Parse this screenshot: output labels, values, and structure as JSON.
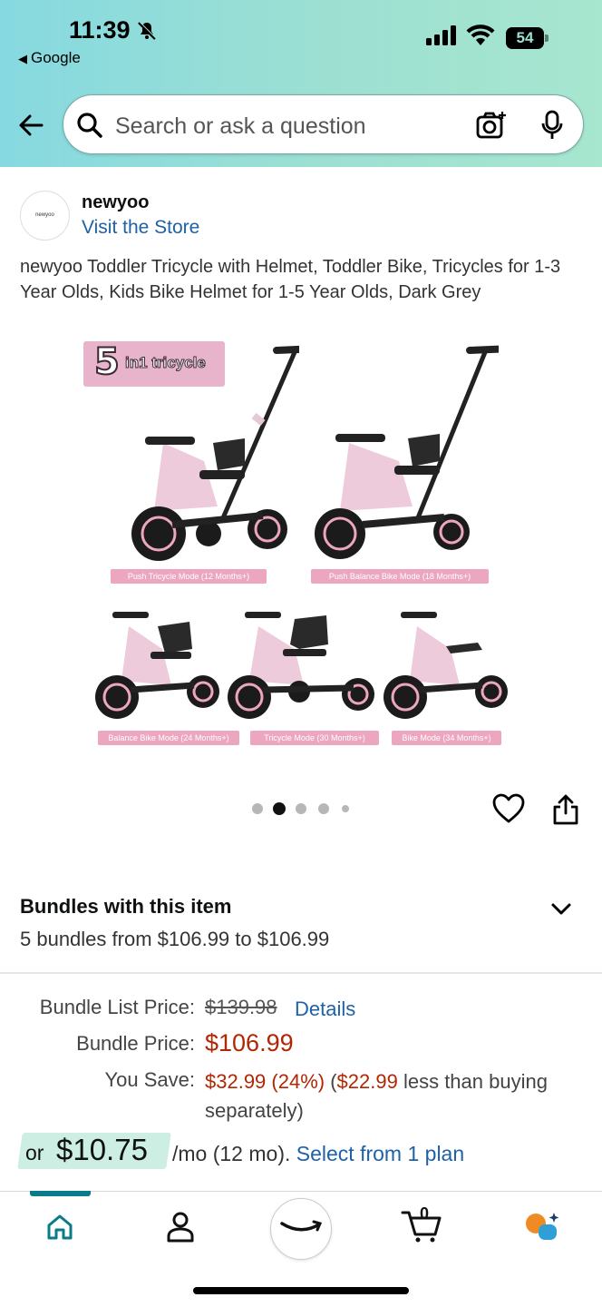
{
  "status_bar": {
    "time": "11:39",
    "back_app": "Google",
    "battery": "54"
  },
  "search": {
    "placeholder": "Search or ask a question"
  },
  "store": {
    "logo_text": "newyoo",
    "name": "newyoo",
    "link": "Visit the Store"
  },
  "product": {
    "title": "newyoo Toddler Tricycle with Helmet, Toddler Bike, Tricycles for 1-3 Year Olds, Kids Bike Helmet for 1-5 Year Olds, Dark Grey",
    "badge_num": "5",
    "badge_text": "in1 tricycle",
    "modes": [
      "Push Tricycle Mode (12 Months+)",
      "Push Balance Bike Mode (18 Months+)",
      "Balance Bike Mode (24 Months+)",
      "Tricycle Mode (30 Months+)",
      "Bike Mode (34 Months+)"
    ],
    "carousel": {
      "total": 5,
      "active_index": 1
    }
  },
  "bundles": {
    "title": "Bundles with this item",
    "subtitle": "5 bundles from $106.99 to $106.99",
    "list_price_label": "Bundle List Price:",
    "list_price": "$139.98",
    "details_link": "Details",
    "price_label": "Bundle Price:",
    "price": "$106.99",
    "save_label": "You Save:",
    "save_amount": "$32.99 (24%)",
    "save_paren_open": "(",
    "save_separate_amount": "$22.99",
    "save_rest": " less than buying separately)",
    "monthly_or": "or",
    "monthly_amount": "$10.75",
    "monthly_text": "/mo (12 mo). ",
    "monthly_link": "Select from 1 plan"
  },
  "colors": {
    "accent_link": "#1e61a8",
    "price_red": "#b12704",
    "nav_teal": "#0a7b89",
    "header_start": "#86d9e0",
    "header_end": "#a7e6cf"
  },
  "nav": {
    "items": [
      "home-icon",
      "account-icon",
      "amazon-smile-icon",
      "cart-icon",
      "rufus-ai-icon"
    ],
    "cart_count": "0",
    "active": "home"
  }
}
